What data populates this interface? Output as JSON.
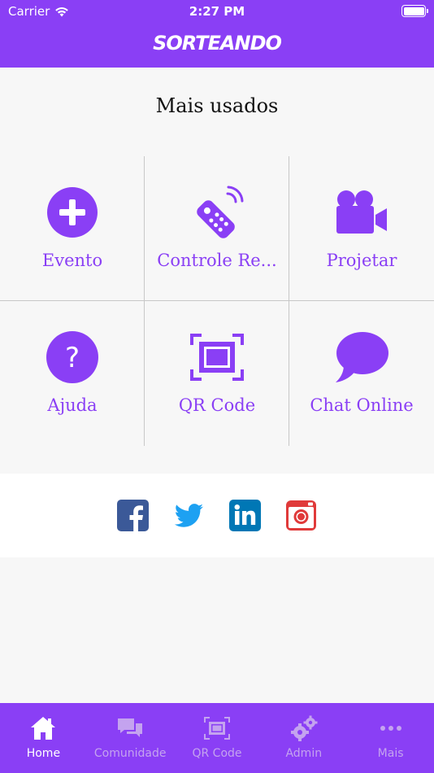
{
  "status_bar": {
    "carrier": "Carrier",
    "time": "2:27 PM"
  },
  "header": {
    "logo": "SORTEANDO"
  },
  "section_title": "Mais usados",
  "shortcuts": [
    {
      "label": "Evento",
      "icon": "plus-circle-icon"
    },
    {
      "label": "Controle Re...",
      "icon": "remote-control-icon"
    },
    {
      "label": "Projetar",
      "icon": "video-camera-icon"
    },
    {
      "label": "Ajuda",
      "icon": "question-circle-icon"
    },
    {
      "label": "QR Code",
      "icon": "qr-scan-icon"
    },
    {
      "label": "Chat Online",
      "icon": "chat-bubble-icon"
    }
  ],
  "social": [
    {
      "icon": "facebook-icon",
      "color": "#3b5998"
    },
    {
      "icon": "twitter-icon",
      "color": "#1da1f2"
    },
    {
      "icon": "linkedin-icon",
      "color": "#0077b5"
    },
    {
      "icon": "instagram-icon",
      "color": "#e03a3a"
    }
  ],
  "tabbar": [
    {
      "label": "Home",
      "icon": "home-icon",
      "active": true
    },
    {
      "label": "Comunidade",
      "icon": "chat-bubbles-icon",
      "active": false
    },
    {
      "label": "QR Code",
      "icon": "qr-scan-icon",
      "active": false
    },
    {
      "label": "Admin",
      "icon": "gears-icon",
      "active": false
    },
    {
      "label": "Mais",
      "icon": "more-dots-icon",
      "active": false
    }
  ],
  "colors": {
    "brand": "#8a3ff5",
    "tab_inactive": "#c4a3ef"
  }
}
